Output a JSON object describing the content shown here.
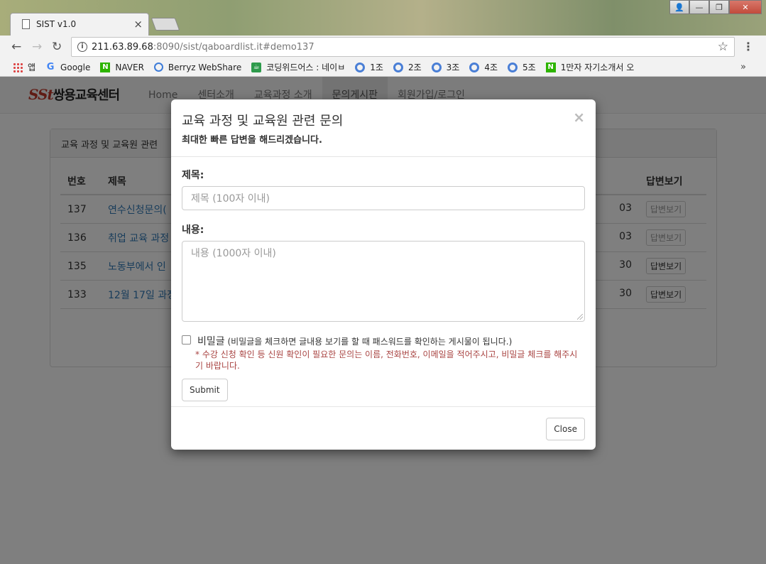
{
  "browser": {
    "tab_title": "SIST v1.0",
    "tab_close": "×",
    "url_host": "211.63.89.68",
    "url_rest": ":8090/sist/qaboardlist.it#demo137",
    "window_buttons": [
      "👤",
      "—",
      "❐",
      "✕"
    ],
    "bookmarks": [
      {
        "label": "앱",
        "icon": "apps-icon"
      },
      {
        "label": "Google",
        "icon": "google-icon"
      },
      {
        "label": "NAVER",
        "icon": "naver-icon"
      },
      {
        "label": "Berryz WebShare",
        "icon": "berryz-icon"
      },
      {
        "label": "코딩위드어스 : 네이ㅂ",
        "icon": "coding-icon"
      },
      {
        "label": "1조",
        "icon": "target-icon"
      },
      {
        "label": "2조",
        "icon": "target-icon"
      },
      {
        "label": "3조",
        "icon": "target-icon"
      },
      {
        "label": "4조",
        "icon": "target-icon"
      },
      {
        "label": "5조",
        "icon": "target-icon"
      },
      {
        "label": "1만자 자기소개서 오",
        "icon": "naver-icon"
      }
    ],
    "bookmarks_more": "»"
  },
  "site": {
    "brand_logo": "SSt",
    "brand_name": "쌍용교육센터",
    "nav": [
      "Home",
      "센터소개",
      "교육과정 소개",
      "문의게시판",
      "회원가입/로그인"
    ],
    "active_nav": 3,
    "panel_title": "교육 과정 및 교육원 관련",
    "table": {
      "headers": [
        "번호",
        "제목",
        "답변보기"
      ],
      "rows": [
        {
          "no": "137",
          "title": "연수신청문의(",
          "date": "03",
          "answer": "답변보기"
        },
        {
          "no": "136",
          "title": "취업 교육 과정",
          "date": "03",
          "answer": "답변보기"
        },
        {
          "no": "135",
          "title": "노동부에서 인",
          "date": "30",
          "answer": "답변보기"
        },
        {
          "no": "133",
          "title": "12월 17일 과정",
          "date": "30",
          "answer": "답변보기"
        }
      ]
    }
  },
  "modal": {
    "title": "교육 과정 및 교육원 관련 문의",
    "subtitle": "최대한 빠른 답변을 해드리겠습니다.",
    "close_x": "×",
    "subject_label": "제목:",
    "subject_placeholder": "제목 (100자 이내)",
    "content_label": "내용:",
    "content_placeholder": "내용 (1000자 이내)",
    "secret_label": "비밀글",
    "secret_desc": "(비밀글을 체크하면 글내용 보기를 할 때 패스워드를 확인하는 게시물이 됩니다.)",
    "secret_warning": "* 수강 신청 확인 등 신원 확인이 필요한 문의는 이름, 전화번호, 이메일을 적어주시고, 비밀글 체크를 해주시기 바랍니다.",
    "submit_label": "Submit",
    "close_label": "Close"
  }
}
